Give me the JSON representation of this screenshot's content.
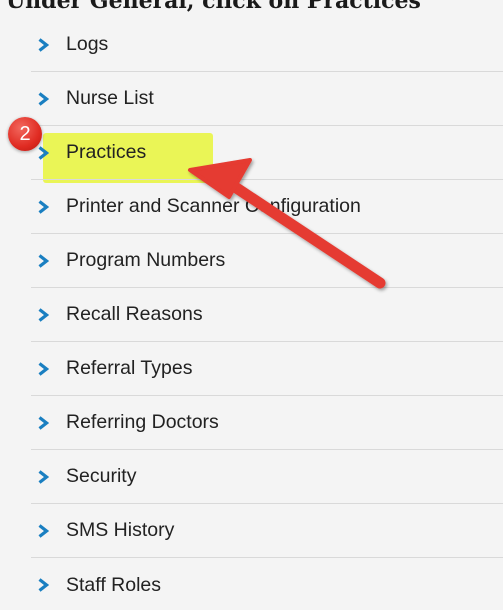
{
  "instruction": "Under General, click on Practices",
  "step_badge": "2",
  "colors": {
    "chevron": "#1a7fc1",
    "highlight": "#e8f53a",
    "arrow": "#e53a30",
    "badge": "#e02b22",
    "divider": "#d9d9d9"
  },
  "menu": {
    "chevron_icon": "chevron-right-icon",
    "items": [
      {
        "label": "Logs"
      },
      {
        "label": "Nurse List"
      },
      {
        "label": "Practices"
      },
      {
        "label": "Printer and Scanner Configuration"
      },
      {
        "label": "Program Numbers"
      },
      {
        "label": "Recall Reasons"
      },
      {
        "label": "Referral Types"
      },
      {
        "label": "Referring Doctors"
      },
      {
        "label": "Security"
      },
      {
        "label": "SMS History"
      },
      {
        "label": "Staff Roles"
      }
    ]
  }
}
